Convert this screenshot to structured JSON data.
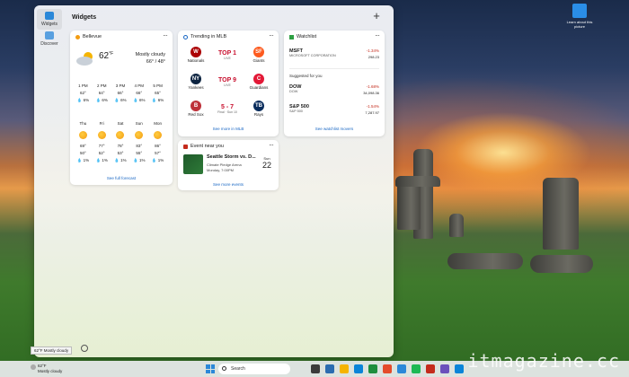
{
  "board": {
    "title": "Widgets",
    "add_label": "+",
    "rail": [
      {
        "label": "Widgets",
        "color": "#2b88d8"
      },
      {
        "label": "Discover",
        "color": "#5aa0e0"
      }
    ]
  },
  "weather": {
    "location": "Bellevue",
    "temp": "62",
    "unit": "°F",
    "condition": "Mostly cloudy",
    "hi_lo": "66° / 48°",
    "hourly": [
      {
        "time": "1 PM",
        "temp": "62°",
        "precip": "6%"
      },
      {
        "time": "2 PM",
        "temp": "64°",
        "precip": "6%"
      },
      {
        "time": "3 PM",
        "temp": "66°",
        "precip": "6%"
      },
      {
        "time": "4 PM",
        "temp": "66°",
        "precip": "6%"
      },
      {
        "time": "5 PM",
        "temp": "65°",
        "precip": "6%"
      }
    ],
    "daily": [
      {
        "day": "Thu",
        "hi": "69°",
        "lo": "50°",
        "precip": "1%"
      },
      {
        "day": "Fri",
        "hi": "77°",
        "lo": "52°",
        "precip": "1%"
      },
      {
        "day": "Sat",
        "hi": "78°",
        "lo": "53°",
        "precip": "1%"
      },
      {
        "day": "Sun",
        "hi": "83°",
        "lo": "55°",
        "precip": "1%"
      },
      {
        "day": "Mon",
        "hi": "86°",
        "lo": "57°",
        "precip": "1%"
      }
    ],
    "link": "See full forecast"
  },
  "mlb": {
    "title": "Trending in MLB",
    "games": [
      {
        "home": "Nationals",
        "away": "Giants",
        "center": "TOP 1",
        "status": "LIVE",
        "home_color": "#ab0003",
        "away_color": "#fd5a1e",
        "home_mark": "W",
        "away_mark": "SF"
      },
      {
        "home": "Yankees",
        "away": "Guardians",
        "center": "TOP 9",
        "status": "LIVE",
        "home_color": "#0c2340",
        "away_color": "#e31937",
        "home_mark": "NY",
        "away_mark": "C"
      },
      {
        "home": "Red Sox",
        "away": "Rays",
        "center": "5 - 7",
        "status": "Final · Sun 10",
        "home_color": "#bd3039",
        "away_color": "#092c5c",
        "home_mark": "B",
        "away_mark": "TB"
      }
    ],
    "link": "See more in MLB"
  },
  "watchlist": {
    "title": "Watchlist",
    "main": {
      "symbol": "MSFT",
      "name": "MICROSOFT CORPORATION",
      "change": "-1.34%",
      "price": "298.23"
    },
    "suggested_label": "Suggested for you",
    "suggested": [
      {
        "symbol": "DOW",
        "name": "DOW",
        "change": "-1.68%",
        "price": "34,098.36"
      },
      {
        "symbol": "S&P 500",
        "name": "S&P 500",
        "change": "-1.54%",
        "price": "7,287.97"
      }
    ],
    "link": "See watchlist movers"
  },
  "event": {
    "title": "Event near you",
    "name": "Seattle Storm vs. D...",
    "venue": "Climate Pledge Arena",
    "time": "Monday, 7:00PM",
    "month": "Sun",
    "day": "22",
    "link": "See more events"
  },
  "tooltip": "62°F Mostly cloudy",
  "taskbar": {
    "temp": "62°F",
    "condition": "Mostly cloudy",
    "search": "Search",
    "apps": [
      "#3b3b3b",
      "#2b6cb0",
      "#f5b400",
      "#0a84d8",
      "#1e8e3e",
      "#e44b2b",
      "#2b88d8",
      "#1db954",
      "#c42b1c",
      "#6b4fbb",
      "#0a84d8"
    ]
  },
  "desktop": {
    "icon_label": "Learn about this picture"
  },
  "watermark": "itmagazine.cc"
}
